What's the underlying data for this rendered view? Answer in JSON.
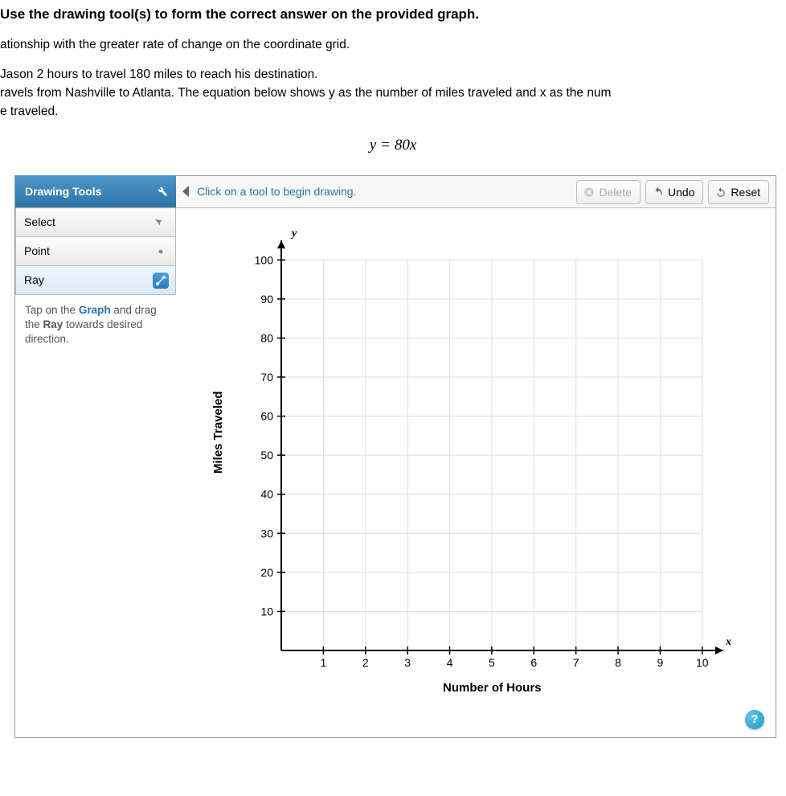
{
  "question": {
    "instruction": "Use the drawing tool(s) to form the correct answer on the provided graph.",
    "line1": "ationship with the greater rate of change on the coordinate grid.",
    "line2": "Jason 2 hours to travel 180 miles to reach his destination.",
    "line3": "ravels from Nashville to Atlanta. The equation below shows y as the number of miles traveled and x as the num",
    "line4": "e traveled.",
    "equation_y": "y",
    "equation_eq": "=",
    "equation_rhs": "80x"
  },
  "toolbar": {
    "header": "Drawing Tools",
    "hint": "Click on a tool to begin drawing.",
    "delete": "Delete",
    "undo": "Undo",
    "reset": "Reset"
  },
  "tools": {
    "select": "Select",
    "point": "Point",
    "ray": "Ray"
  },
  "tip": {
    "pre": "Tap on the ",
    "kw1": "Graph",
    "mid": " and drag the ",
    "kw2": "Ray",
    "post": " towards desired direction."
  },
  "chart_data": {
    "type": "scatter",
    "title": "",
    "xlabel": "Number of Hours",
    "ylabel": "Miles Traveled",
    "x_axis_var": "x",
    "y_axis_var": "y",
    "xlim": [
      0,
      10.5
    ],
    "ylim": [
      0,
      105
    ],
    "x_ticks": [
      1,
      2,
      3,
      4,
      5,
      6,
      7,
      8,
      9,
      10
    ],
    "y_ticks": [
      10,
      20,
      30,
      40,
      50,
      60,
      70,
      80,
      90,
      100
    ],
    "series": []
  },
  "help": "?"
}
